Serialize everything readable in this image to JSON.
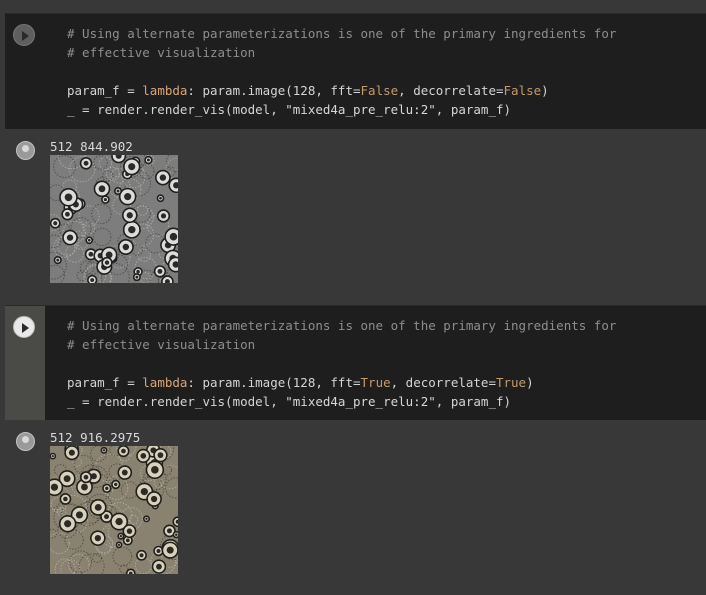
{
  "cells": [
    {
      "comment1": "# Using alternate parameterizations is one of the primary ingredients for",
      "comment2": "# effective visualization",
      "line3_a": "param_f = ",
      "line3_kw": "lambda",
      "line3_b": ": param.image(128, fft=",
      "line3_fft": "False",
      "line3_c": ", decorrelate=",
      "line3_dec": "False",
      "line3_d": ")",
      "line4_a": "_ = render.render_vis(model, ",
      "line4_str": "\"mixed4a_pre_relu:2\"",
      "line4_b": ", param_f)",
      "output_text": "512 844.902",
      "run_state": "idle",
      "image_desc": "feature visualization"
    },
    {
      "comment1": "# Using alternate parameterizations is one of the primary ingredients for",
      "comment2": "# effective visualization",
      "line3_a": "param_f = ",
      "line3_kw": "lambda",
      "line3_b": ": param.image(128, fft=",
      "line3_fft": "True",
      "line3_c": ", decorrelate=",
      "line3_dec": "True",
      "line3_d": ")",
      "line4_a": "_ = render.render_vis(model, ",
      "line4_str": "\"mixed4a_pre_relu:2\"",
      "line4_b": ", param_f)",
      "output_text": "512 916.2975",
      "run_state": "active",
      "image_desc": "feature visualization"
    }
  ],
  "colors": {
    "background": "#383838",
    "code_bg": "#1e1e1e",
    "comment": "#8e8e8e",
    "keyword": "#d8a67a"
  },
  "icons": [
    "play-icon",
    "output-icon"
  ]
}
